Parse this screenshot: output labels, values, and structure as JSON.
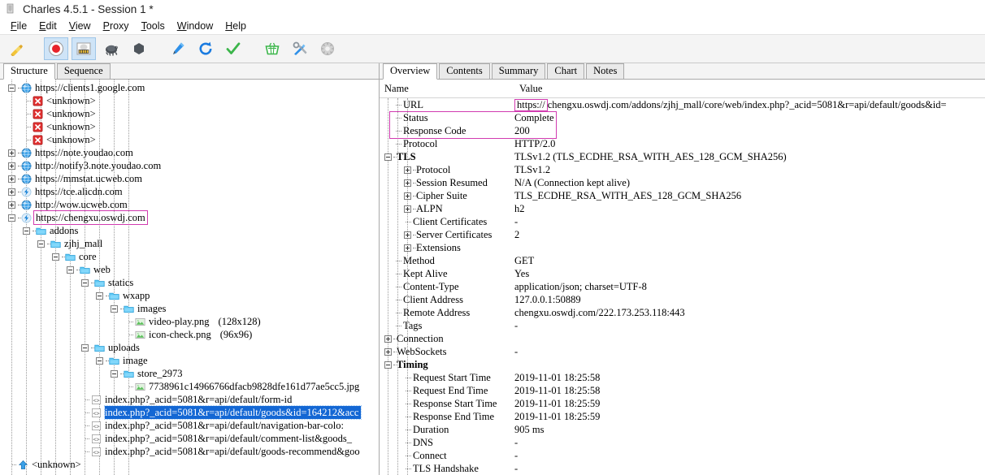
{
  "window": {
    "title": "Charles 4.5.1 - Session 1 *",
    "icon": "charles-app-icon"
  },
  "menubar": {
    "items": [
      {
        "label": "File",
        "mnemonic": "F"
      },
      {
        "label": "Edit",
        "mnemonic": "E"
      },
      {
        "label": "View",
        "mnemonic": "V"
      },
      {
        "label": "Proxy",
        "mnemonic": "P"
      },
      {
        "label": "Tools",
        "mnemonic": "T"
      },
      {
        "label": "Window",
        "mnemonic": "W"
      },
      {
        "label": "Help",
        "mnemonic": "H"
      }
    ]
  },
  "toolbar": {
    "buttons": [
      {
        "name": "clear-session-icon",
        "icon": "broom",
        "active": false
      },
      {
        "name": "start-stop-recording-icon",
        "icon": "record",
        "active": true
      },
      {
        "name": "throttle-settings-icon",
        "icon": "throttle",
        "active": true
      },
      {
        "name": "breakpoint-settings-icon",
        "icon": "turtle-dark",
        "active": false
      },
      {
        "name": "compose-icon",
        "icon": "hexagon",
        "active": false
      },
      {
        "name": "tools-pen-icon",
        "icon": "pen",
        "active": false
      },
      {
        "name": "repeat-icon",
        "icon": "repeat-arrow",
        "active": false
      },
      {
        "name": "validate-icon",
        "icon": "checkmark",
        "active": false
      },
      {
        "name": "basket-icon",
        "icon": "basket",
        "active": false
      },
      {
        "name": "tools-icon",
        "icon": "wrench-screwdriver",
        "active": false
      },
      {
        "name": "settings-icon",
        "icon": "gear-ball",
        "active": false
      }
    ]
  },
  "left_panel": {
    "tabs": [
      {
        "label": "Structure",
        "selected": true
      },
      {
        "label": "Sequence",
        "selected": false
      }
    ],
    "tree": [
      {
        "depth": 0,
        "twisty": "minus",
        "icon": "globe",
        "label": "https://clients1.google.com"
      },
      {
        "depth": 1,
        "twisty": "none",
        "icon": "error-x",
        "label": "<unknown>"
      },
      {
        "depth": 1,
        "twisty": "none",
        "icon": "error-x",
        "label": "<unknown>"
      },
      {
        "depth": 1,
        "twisty": "none",
        "icon": "error-x",
        "label": "<unknown>"
      },
      {
        "depth": 1,
        "twisty": "none",
        "icon": "error-x",
        "label": "<unknown>"
      },
      {
        "depth": 0,
        "twisty": "plus",
        "icon": "globe",
        "label": "https://note.youdao.com"
      },
      {
        "depth": 0,
        "twisty": "plus",
        "icon": "globe",
        "label": "http://notify3.note.youdao.com"
      },
      {
        "depth": 0,
        "twisty": "plus",
        "icon": "globe",
        "label": "https://mmstat.ucweb.com"
      },
      {
        "depth": 0,
        "twisty": "plus",
        "icon": "bolt",
        "label": "https://tce.alicdn.com"
      },
      {
        "depth": 0,
        "twisty": "plus",
        "icon": "globe",
        "label": "http://wow.ucweb.com"
      },
      {
        "depth": 0,
        "twisty": "minus",
        "icon": "bolt",
        "label": "https://chengxu.oswdj.com",
        "highlight": "pink-box"
      },
      {
        "depth": 1,
        "twisty": "minus",
        "icon": "folder",
        "label": "addons"
      },
      {
        "depth": 2,
        "twisty": "minus",
        "icon": "folder",
        "label": "zjhj_mall"
      },
      {
        "depth": 3,
        "twisty": "minus",
        "icon": "folder",
        "label": "core"
      },
      {
        "depth": 4,
        "twisty": "minus",
        "icon": "folder",
        "label": "web"
      },
      {
        "depth": 5,
        "twisty": "minus",
        "icon": "folder",
        "label": "statics"
      },
      {
        "depth": 6,
        "twisty": "minus",
        "icon": "folder",
        "label": "wxapp"
      },
      {
        "depth": 7,
        "twisty": "minus",
        "icon": "folder",
        "label": "images"
      },
      {
        "depth": 8,
        "twisty": "none",
        "icon": "image",
        "label": "video-play.png",
        "meta": "(128x128)"
      },
      {
        "depth": 8,
        "twisty": "none",
        "icon": "image",
        "label": "icon-check.png",
        "meta": "(96x96)"
      },
      {
        "depth": 5,
        "twisty": "minus",
        "icon": "folder",
        "label": "uploads"
      },
      {
        "depth": 6,
        "twisty": "minus",
        "icon": "folder",
        "label": "image"
      },
      {
        "depth": 7,
        "twisty": "minus",
        "icon": "folder",
        "label": "store_2973"
      },
      {
        "depth": 8,
        "twisty": "none",
        "icon": "image",
        "label": "7738961c14966766dfacb9828dfe161d77ae5cc5.jpg"
      },
      {
        "depth": 5,
        "twisty": "none",
        "icon": "code",
        "label": "index.php?_acid=5081&r=api/default/form-id"
      },
      {
        "depth": 5,
        "twisty": "none",
        "icon": "code",
        "label": "index.php?_acid=5081&r=api/default/goods&id=164212&acc",
        "selected": true
      },
      {
        "depth": 5,
        "twisty": "none",
        "icon": "code",
        "label": "index.php?_acid=5081&r=api/default/navigation-bar-colo:"
      },
      {
        "depth": 5,
        "twisty": "none",
        "icon": "code",
        "label": "index.php?_acid=5081&r=api/default/comment-list&goods_"
      },
      {
        "depth": 5,
        "twisty": "none",
        "icon": "code",
        "label": "index.php?_acid=5081&r=api/default/goods-recommend&goo"
      },
      {
        "depth": 0,
        "twisty": "none",
        "icon": "blue-arrow-up",
        "label": "<unknown>"
      }
    ]
  },
  "right_panel": {
    "tabs": [
      {
        "label": "Overview",
        "selected": true
      },
      {
        "label": "Contents",
        "selected": false
      },
      {
        "label": "Summary",
        "selected": false
      },
      {
        "label": "Chart",
        "selected": false
      },
      {
        "label": "Notes",
        "selected": false
      }
    ],
    "columns": {
      "name": "Name",
      "value": "Value"
    },
    "rows": [
      {
        "indent": 1,
        "twisty": "leaf",
        "name": "URL",
        "value": "https://chengxu.oswdj.com/addons/zjhj_mall/core/web/index.php?_acid=5081&r=api/default/goods&id=",
        "value_highlight": "pink-prefix"
      },
      {
        "indent": 1,
        "twisty": "leaf",
        "name": "Status",
        "value": "Complete"
      },
      {
        "indent": 1,
        "twisty": "leaf",
        "name": "Response Code",
        "value": "200"
      },
      {
        "indent": 1,
        "twisty": "leaf",
        "name": "Protocol",
        "value": "HTTP/2.0"
      },
      {
        "indent": 0,
        "twisty": "minus",
        "name": "TLS",
        "value": "TLSv1.2 (TLS_ECDHE_RSA_WITH_AES_128_GCM_SHA256)",
        "bold": true
      },
      {
        "indent": 2,
        "twisty": "plus",
        "name": "Protocol",
        "value": "TLSv1.2"
      },
      {
        "indent": 2,
        "twisty": "plus",
        "name": "Session Resumed",
        "value": "N/A (Connection kept alive)"
      },
      {
        "indent": 2,
        "twisty": "plus",
        "name": "Cipher Suite",
        "value": "TLS_ECDHE_RSA_WITH_AES_128_GCM_SHA256"
      },
      {
        "indent": 2,
        "twisty": "plus",
        "name": "ALPN",
        "value": "h2"
      },
      {
        "indent": 2,
        "twisty": "leaf",
        "name": "Client Certificates",
        "value": "-"
      },
      {
        "indent": 2,
        "twisty": "plus",
        "name": "Server Certificates",
        "value": "2"
      },
      {
        "indent": 2,
        "twisty": "plus",
        "name": "Extensions",
        "value": ""
      },
      {
        "indent": 1,
        "twisty": "leaf",
        "name": "Method",
        "value": "GET"
      },
      {
        "indent": 1,
        "twisty": "leaf",
        "name": "Kept Alive",
        "value": "Yes"
      },
      {
        "indent": 1,
        "twisty": "leaf",
        "name": "Content-Type",
        "value": "application/json; charset=UTF-8"
      },
      {
        "indent": 1,
        "twisty": "leaf",
        "name": "Client Address",
        "value": "127.0.0.1:50889"
      },
      {
        "indent": 1,
        "twisty": "leaf",
        "name": "Remote Address",
        "value": "chengxu.oswdj.com/222.173.253.118:443"
      },
      {
        "indent": 1,
        "twisty": "leaf",
        "name": "Tags",
        "value": "-"
      },
      {
        "indent": 0,
        "twisty": "plus",
        "name": "Connection",
        "value": ""
      },
      {
        "indent": 0,
        "twisty": "plus",
        "name": "WebSockets",
        "value": "-"
      },
      {
        "indent": 0,
        "twisty": "minus",
        "name": "Timing",
        "value": "",
        "bold": true
      },
      {
        "indent": 2,
        "twisty": "leaf",
        "name": "Request Start Time",
        "value": "2019-11-01 18:25:58"
      },
      {
        "indent": 2,
        "twisty": "leaf",
        "name": "Request End Time",
        "value": "2019-11-01 18:25:58"
      },
      {
        "indent": 2,
        "twisty": "leaf",
        "name": "Response Start Time",
        "value": "2019-11-01 18:25:59"
      },
      {
        "indent": 2,
        "twisty": "leaf",
        "name": "Response End Time",
        "value": "2019-11-01 18:25:59"
      },
      {
        "indent": 2,
        "twisty": "leaf",
        "name": "Duration",
        "value": "905 ms"
      },
      {
        "indent": 2,
        "twisty": "leaf",
        "name": "DNS",
        "value": "-"
      },
      {
        "indent": 2,
        "twisty": "leaf",
        "name": "Connect",
        "value": "-"
      },
      {
        "indent": 2,
        "twisty": "leaf",
        "name": "TLS Handshake",
        "value": "-"
      }
    ]
  },
  "annotations": {
    "highlight_color": "#d13bb0",
    "selection_color": "#1367d4"
  }
}
